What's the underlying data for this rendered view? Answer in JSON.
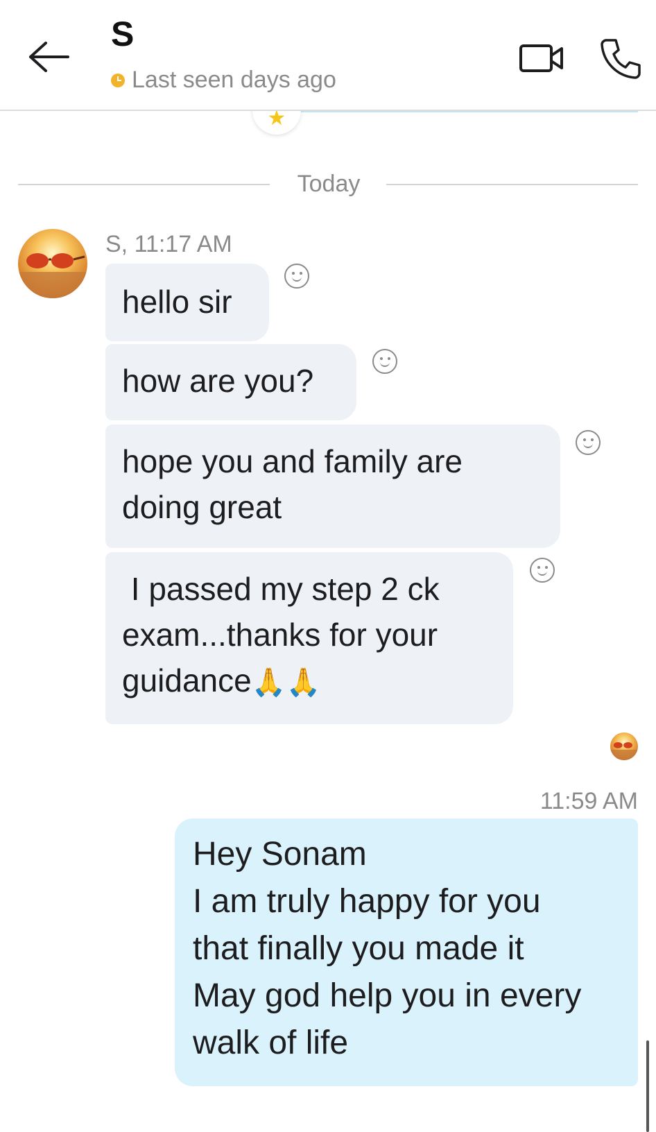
{
  "header": {
    "contact_name": "S",
    "presence": "Last seen days ago"
  },
  "divider": {
    "label": "Today"
  },
  "incoming": {
    "meta": "S, 11:17 AM",
    "messages": [
      {
        "lines": [
          "hello sir"
        ]
      },
      {
        "lines": [
          "how are you?"
        ]
      },
      {
        "lines": [
          "hope you and family are",
          "doing great"
        ]
      },
      {
        "lines": [
          " I passed my step 2 ck",
          "exam...thanks for your",
          "guidance"
        ],
        "emoji": "🙏🙏"
      }
    ]
  },
  "outgoing": {
    "time": "11:59 AM",
    "lines": [
      "Hey Sonam",
      "I am truly happy for you",
      "that finally you made it",
      "May god help you in every",
      "walk of life"
    ]
  },
  "icons": {
    "back": "arrow-left-icon",
    "video": "video-camera-icon",
    "call": "phone-icon",
    "react": "smiley-icon",
    "presence": "clock-icon",
    "highlight": "star-icon"
  },
  "colors": {
    "incoming_bubble": "#eef2f6",
    "outgoing_bubble": "#d9f2fb",
    "presence_dot": "#f2b32c",
    "muted_text": "#8a8a8a"
  }
}
